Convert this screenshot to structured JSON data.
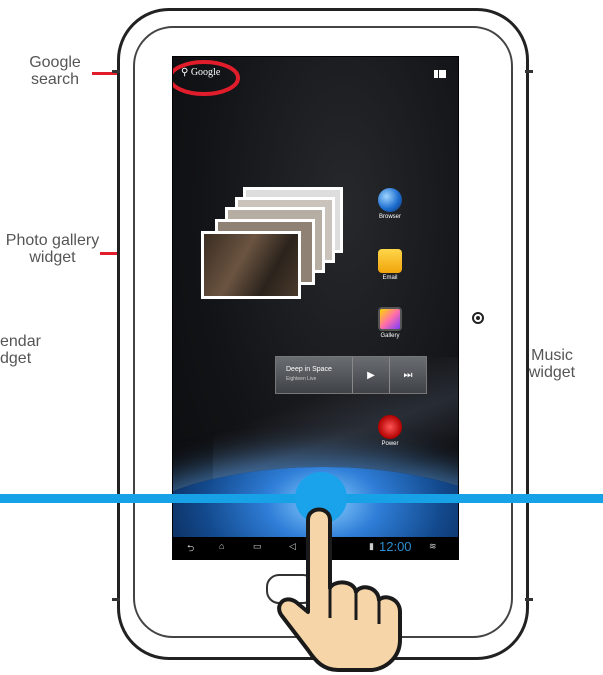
{
  "callouts": {
    "google": {
      "line1": "Google",
      "line2": "search"
    },
    "photo": {
      "line1": "Photo gallery",
      "line2": "widget"
    },
    "calendar": {
      "line1": "endar",
      "line2": "dget"
    },
    "music": {
      "line1": "Music",
      "line2": "widget"
    }
  },
  "screen": {
    "search_label": "Google",
    "apps": [
      {
        "label": "Browser"
      },
      {
        "label": "Email"
      },
      {
        "label": "Gallery"
      },
      {
        "label": "Power"
      }
    ],
    "music_widget": {
      "title": "Deep in Space",
      "artist": "Eighteen Live",
      "play_icon": "▶",
      "next_icon": "⏭"
    },
    "status_bar": {
      "time": "12:00"
    }
  },
  "colors": {
    "callout_red": "#e21d2b",
    "swipe_blue": "#17a2e8"
  },
  "icons": [
    "search-icon",
    "apps-grid-icon",
    "browser-icon",
    "email-icon",
    "gallery-icon",
    "power-icon",
    "play-icon",
    "next-track-icon",
    "back-icon",
    "home-icon",
    "recent-apps-icon",
    "volume-icon",
    "battery-icon",
    "wifi-icon",
    "hand-pointer-icon",
    "camera-icon"
  ]
}
